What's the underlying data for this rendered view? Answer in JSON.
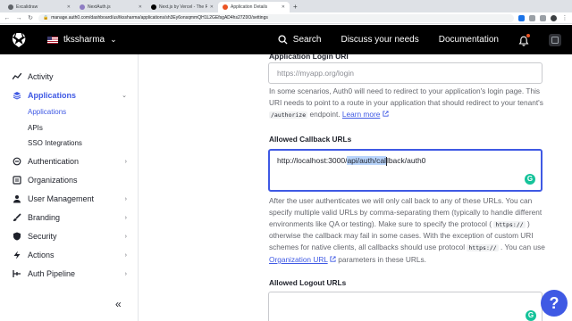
{
  "browser": {
    "tabs": [
      {
        "title": "Excalidraw",
        "active": false
      },
      {
        "title": "NextAuth.js",
        "active": false
      },
      {
        "title": "Next.js by Vercel - The React F",
        "active": false
      },
      {
        "title": "Application Details",
        "active": true
      }
    ],
    "new_tab": "+",
    "url": "manage.auth0.com/dashboard/us/tkssharma/applications/sh3Ey6onsqmmQH1L2GEfsgAD4hs27Z0O/settings"
  },
  "header": {
    "tenant_name": "tkssharma",
    "search_label": "Search",
    "discuss_label": "Discuss your needs",
    "docs_label": "Documentation"
  },
  "sidebar": {
    "activity": "Activity",
    "applications": "Applications",
    "sub": {
      "applications": "Applications",
      "apis": "APIs",
      "sso": "SSO Integrations"
    },
    "authentication": "Authentication",
    "organizations": "Organizations",
    "user_management": "User Management",
    "branding": "Branding",
    "security": "Security",
    "actions": "Actions",
    "auth_pipeline": "Auth Pipeline",
    "collapse_label": "«"
  },
  "main": {
    "login_uri": {
      "placeholder": "https://myapp.org/login",
      "help_pre": "In some scenarios, Auth0 will need to redirect to your application's login page. This URI needs to point to a route in your application that should redirect to your tenant's",
      "help_code": "/authorize",
      "help_post": "endpoint.",
      "learn_more": "Learn more"
    },
    "callback": {
      "label": "Allowed Callback URLs",
      "value_pre": "http://localhost:3000/",
      "value_highlight": "api/auth/cal",
      "value_post": "lback/auth0",
      "help_1": "After the user authenticates we will only call back to any of these URLs. You can specify multiple valid URLs by comma-separating them (typically to handle different environments like QA or testing). Make sure to specify the protocol (",
      "help_code_1": "https://",
      "help_2": ") otherwise the callback may fail in some cases. With the exception of custom URI schemes for native clients, all callbacks should use protocol",
      "help_code_2": "https://",
      "help_3": ". You can use",
      "help_link": "Organization URL",
      "help_4": "parameters in these URLs."
    },
    "logout": {
      "label": "Allowed Logout URLs"
    }
  },
  "help_fab": "?",
  "colors": {
    "accent": "#3f59e4",
    "header_bg": "#000000",
    "grammarly": "#15c39a"
  }
}
